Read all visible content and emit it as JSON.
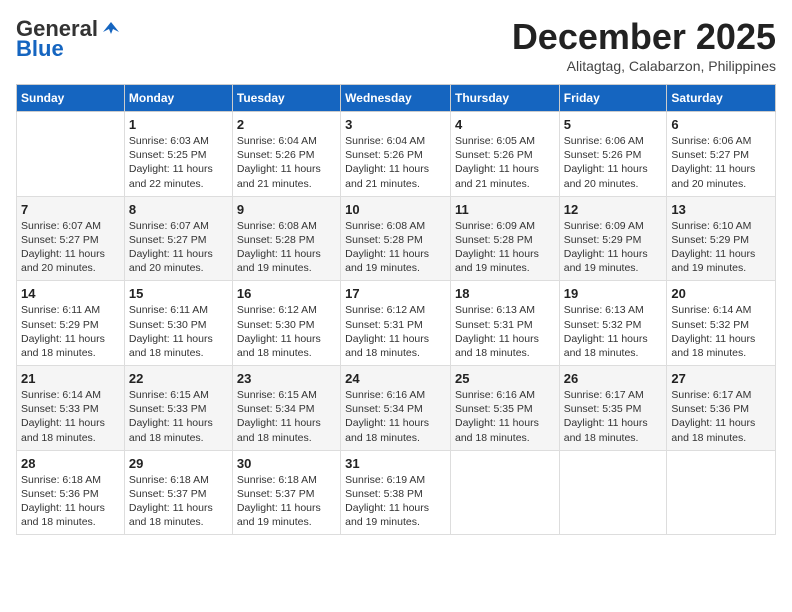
{
  "header": {
    "logo_general": "General",
    "logo_blue": "Blue",
    "month": "December 2025",
    "location": "Alitagtag, Calabarzon, Philippines"
  },
  "columns": [
    "Sunday",
    "Monday",
    "Tuesday",
    "Wednesday",
    "Thursday",
    "Friday",
    "Saturday"
  ],
  "weeks": [
    [
      {
        "day": "",
        "data": ""
      },
      {
        "day": "1",
        "data": "Sunrise: 6:03 AM\nSunset: 5:25 PM\nDaylight: 11 hours\nand 22 minutes."
      },
      {
        "day": "2",
        "data": "Sunrise: 6:04 AM\nSunset: 5:26 PM\nDaylight: 11 hours\nand 21 minutes."
      },
      {
        "day": "3",
        "data": "Sunrise: 6:04 AM\nSunset: 5:26 PM\nDaylight: 11 hours\nand 21 minutes."
      },
      {
        "day": "4",
        "data": "Sunrise: 6:05 AM\nSunset: 5:26 PM\nDaylight: 11 hours\nand 21 minutes."
      },
      {
        "day": "5",
        "data": "Sunrise: 6:06 AM\nSunset: 5:26 PM\nDaylight: 11 hours\nand 20 minutes."
      },
      {
        "day": "6",
        "data": "Sunrise: 6:06 AM\nSunset: 5:27 PM\nDaylight: 11 hours\nand 20 minutes."
      }
    ],
    [
      {
        "day": "7",
        "data": "Sunrise: 6:07 AM\nSunset: 5:27 PM\nDaylight: 11 hours\nand 20 minutes."
      },
      {
        "day": "8",
        "data": "Sunrise: 6:07 AM\nSunset: 5:27 PM\nDaylight: 11 hours\nand 20 minutes."
      },
      {
        "day": "9",
        "data": "Sunrise: 6:08 AM\nSunset: 5:28 PM\nDaylight: 11 hours\nand 19 minutes."
      },
      {
        "day": "10",
        "data": "Sunrise: 6:08 AM\nSunset: 5:28 PM\nDaylight: 11 hours\nand 19 minutes."
      },
      {
        "day": "11",
        "data": "Sunrise: 6:09 AM\nSunset: 5:28 PM\nDaylight: 11 hours\nand 19 minutes."
      },
      {
        "day": "12",
        "data": "Sunrise: 6:09 AM\nSunset: 5:29 PM\nDaylight: 11 hours\nand 19 minutes."
      },
      {
        "day": "13",
        "data": "Sunrise: 6:10 AM\nSunset: 5:29 PM\nDaylight: 11 hours\nand 19 minutes."
      }
    ],
    [
      {
        "day": "14",
        "data": "Sunrise: 6:11 AM\nSunset: 5:29 PM\nDaylight: 11 hours\nand 18 minutes."
      },
      {
        "day": "15",
        "data": "Sunrise: 6:11 AM\nSunset: 5:30 PM\nDaylight: 11 hours\nand 18 minutes."
      },
      {
        "day": "16",
        "data": "Sunrise: 6:12 AM\nSunset: 5:30 PM\nDaylight: 11 hours\nand 18 minutes."
      },
      {
        "day": "17",
        "data": "Sunrise: 6:12 AM\nSunset: 5:31 PM\nDaylight: 11 hours\nand 18 minutes."
      },
      {
        "day": "18",
        "data": "Sunrise: 6:13 AM\nSunset: 5:31 PM\nDaylight: 11 hours\nand 18 minutes."
      },
      {
        "day": "19",
        "data": "Sunrise: 6:13 AM\nSunset: 5:32 PM\nDaylight: 11 hours\nand 18 minutes."
      },
      {
        "day": "20",
        "data": "Sunrise: 6:14 AM\nSunset: 5:32 PM\nDaylight: 11 hours\nand 18 minutes."
      }
    ],
    [
      {
        "day": "21",
        "data": "Sunrise: 6:14 AM\nSunset: 5:33 PM\nDaylight: 11 hours\nand 18 minutes."
      },
      {
        "day": "22",
        "data": "Sunrise: 6:15 AM\nSunset: 5:33 PM\nDaylight: 11 hours\nand 18 minutes."
      },
      {
        "day": "23",
        "data": "Sunrise: 6:15 AM\nSunset: 5:34 PM\nDaylight: 11 hours\nand 18 minutes."
      },
      {
        "day": "24",
        "data": "Sunrise: 6:16 AM\nSunset: 5:34 PM\nDaylight: 11 hours\nand 18 minutes."
      },
      {
        "day": "25",
        "data": "Sunrise: 6:16 AM\nSunset: 5:35 PM\nDaylight: 11 hours\nand 18 minutes."
      },
      {
        "day": "26",
        "data": "Sunrise: 6:17 AM\nSunset: 5:35 PM\nDaylight: 11 hours\nand 18 minutes."
      },
      {
        "day": "27",
        "data": "Sunrise: 6:17 AM\nSunset: 5:36 PM\nDaylight: 11 hours\nand 18 minutes."
      }
    ],
    [
      {
        "day": "28",
        "data": "Sunrise: 6:18 AM\nSunset: 5:36 PM\nDaylight: 11 hours\nand 18 minutes."
      },
      {
        "day": "29",
        "data": "Sunrise: 6:18 AM\nSunset: 5:37 PM\nDaylight: 11 hours\nand 18 minutes."
      },
      {
        "day": "30",
        "data": "Sunrise: 6:18 AM\nSunset: 5:37 PM\nDaylight: 11 hours\nand 19 minutes."
      },
      {
        "day": "31",
        "data": "Sunrise: 6:19 AM\nSunset: 5:38 PM\nDaylight: 11 hours\nand 19 minutes."
      },
      {
        "day": "",
        "data": ""
      },
      {
        "day": "",
        "data": ""
      },
      {
        "day": "",
        "data": ""
      }
    ]
  ]
}
